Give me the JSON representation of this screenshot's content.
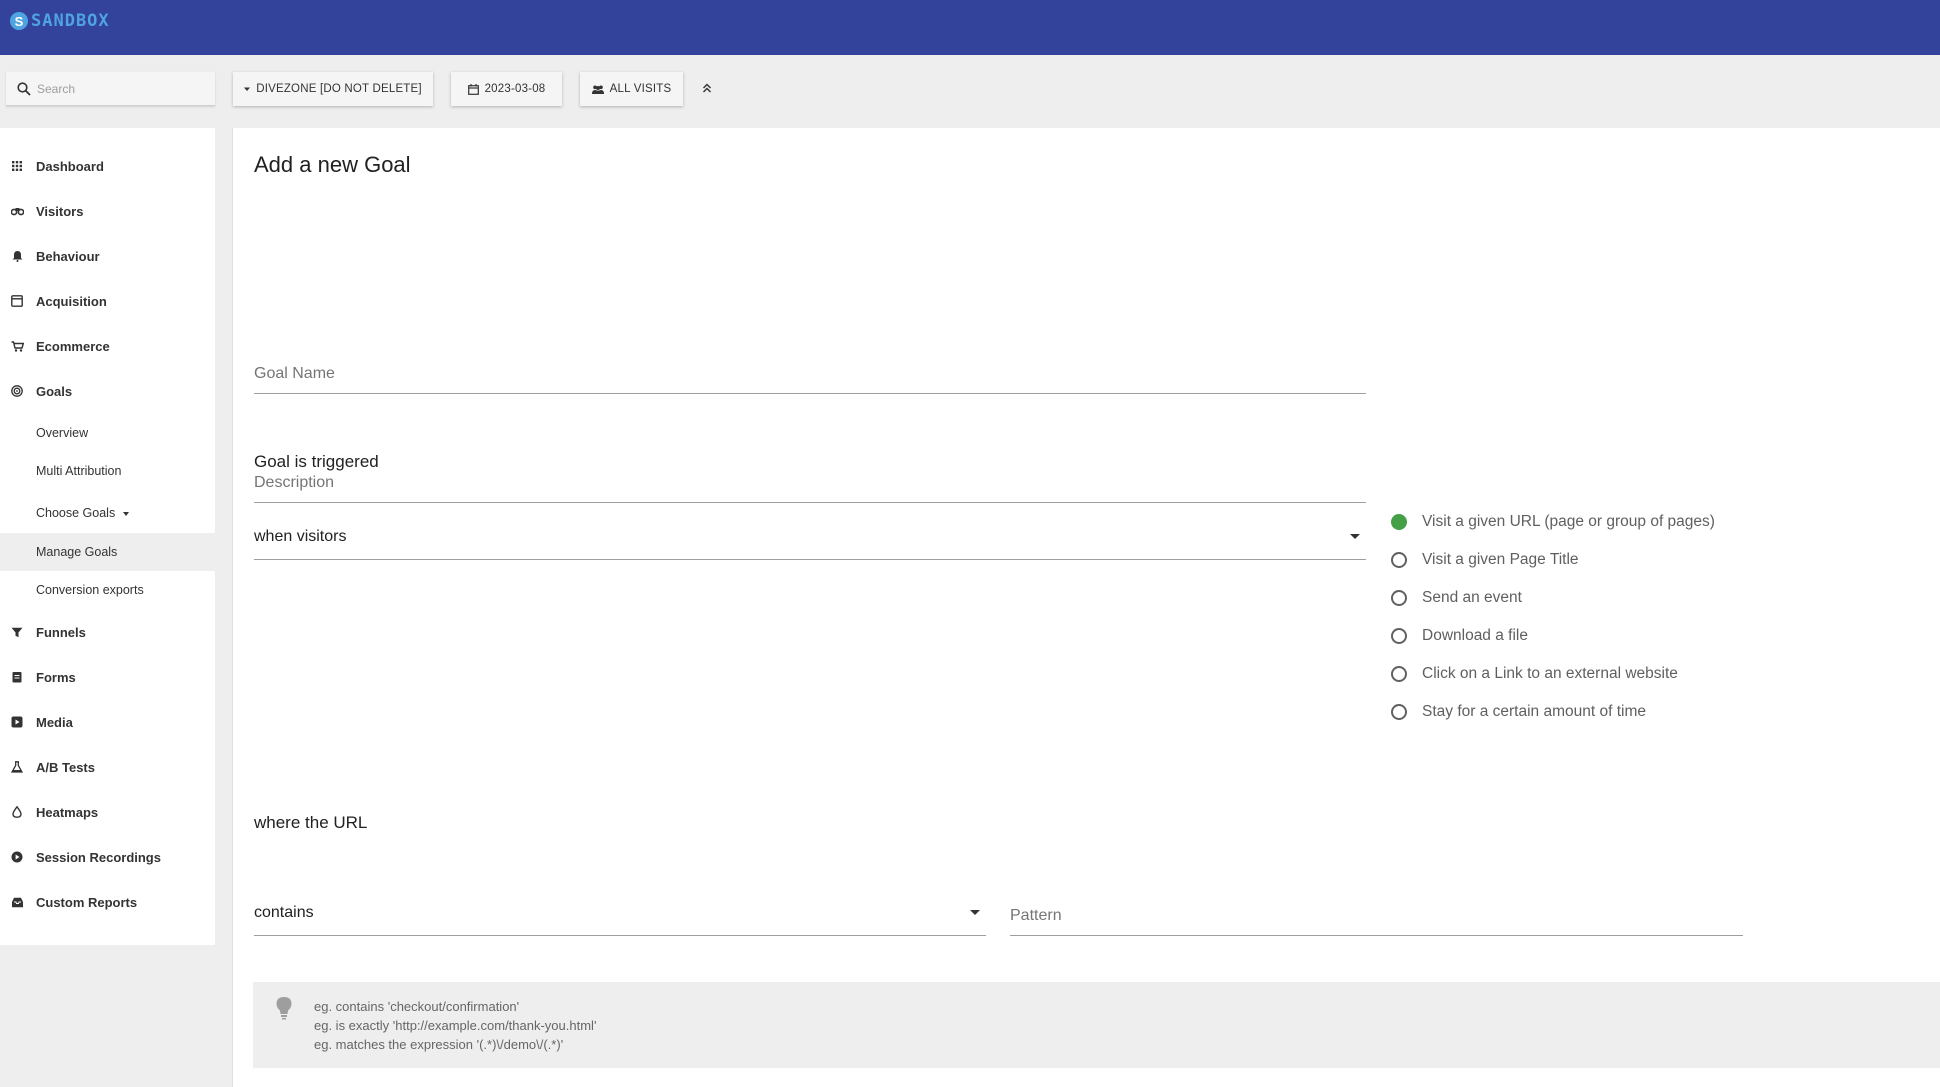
{
  "app": {
    "logo_badge": "S",
    "logo_text": "SANDBOX"
  },
  "toolbar": {
    "search_placeholder": "Search",
    "site_selector": "DIVEZONE [DO NOT DELETE]",
    "date": "2023-03-08",
    "segment": "ALL VISITS"
  },
  "sidebar": {
    "items": [
      {
        "label": "Dashboard",
        "icon": "grid-icon"
      },
      {
        "label": "Visitors",
        "icon": "binoculars-icon"
      },
      {
        "label": "Behaviour",
        "icon": "bell-icon"
      },
      {
        "label": "Acquisition",
        "icon": "browser-icon"
      },
      {
        "label": "Ecommerce",
        "icon": "cart-icon"
      },
      {
        "label": "Goals",
        "icon": "target-icon"
      }
    ],
    "goals_sub": {
      "overview": "Overview",
      "multi_attribution": "Multi Attribution",
      "choose_goals": "Choose Goals",
      "manage_goals": "Manage Goals",
      "conversion_exports": "Conversion exports"
    },
    "items_after": [
      {
        "label": "Funnels",
        "icon": "funnel-icon"
      },
      {
        "label": "Forms",
        "icon": "form-icon"
      },
      {
        "label": "Media",
        "icon": "media-icon"
      },
      {
        "label": "A/B Tests",
        "icon": "flask-icon"
      },
      {
        "label": "Heatmaps",
        "icon": "drop-icon"
      },
      {
        "label": "Session Recordings",
        "icon": "play-icon"
      },
      {
        "label": "Custom Reports",
        "icon": "inbox-icon"
      }
    ]
  },
  "form": {
    "title": "Add a new Goal",
    "goal_name_placeholder": "Goal Name",
    "description_placeholder": "Description",
    "triggered_label": "Goal is triggered",
    "trigger_select": "when visitors",
    "trigger_options": [
      {
        "label": "Visit a given URL (page or group of pages)",
        "checked": true
      },
      {
        "label": "Visit a given Page Title",
        "checked": false
      },
      {
        "label": "Send an event",
        "checked": false
      },
      {
        "label": "Download a file",
        "checked": false
      },
      {
        "label": "Click on a Link to an external website",
        "checked": false
      },
      {
        "label": "Stay for a certain amount of time",
        "checked": false
      }
    ],
    "where_label": "where the URL",
    "match_select": "contains",
    "pattern_placeholder": "Pattern",
    "hints": [
      "eg. contains 'checkout/confirmation'",
      "eg. is exactly 'http://example.com/thank-you.html'",
      "eg. matches the expression '(.*)\\/demo\\/(.*)'"
    ]
  },
  "colors": {
    "header": "#33429a",
    "radio_checked": "#43a047"
  }
}
